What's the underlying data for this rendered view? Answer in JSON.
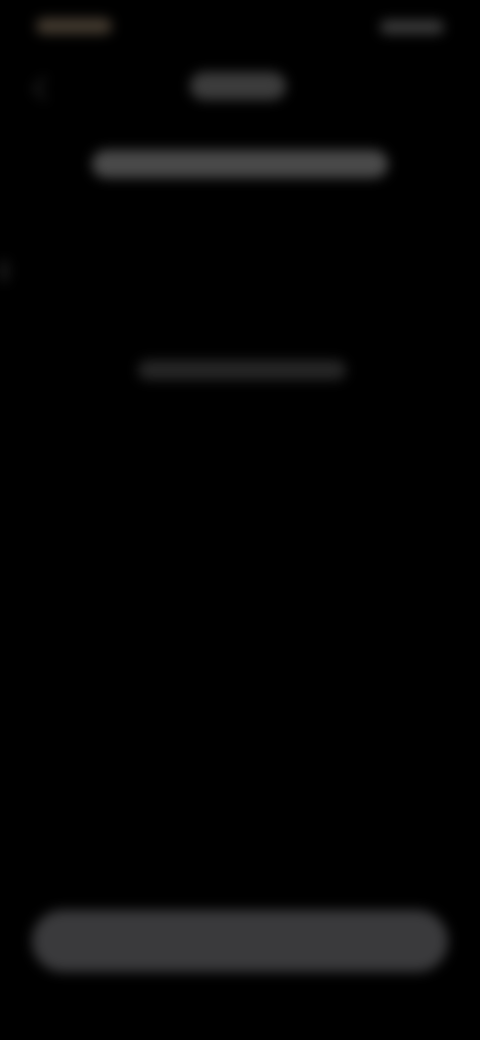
{
  "status_bar": {
    "time": "",
    "indicators": ""
  },
  "header": {
    "back_icon": "chevron-left-icon",
    "title": ""
  },
  "main": {
    "subtitle": "",
    "helper_text": ""
  },
  "footer": {
    "primary_button_label": ""
  },
  "colors": {
    "background": "#000000",
    "button": "#3a3a3c",
    "status_accent": "#4a4034"
  }
}
